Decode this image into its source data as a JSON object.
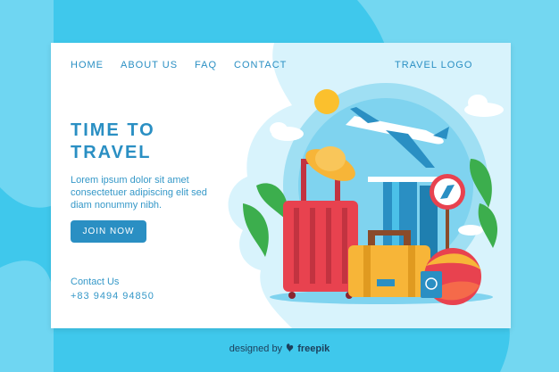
{
  "nav": {
    "items": [
      {
        "label": "HOME"
      },
      {
        "label": "ABOUT US"
      },
      {
        "label": "FAQ"
      },
      {
        "label": "CONTACT"
      }
    ],
    "logo": "TRAVEL LOGO"
  },
  "hero": {
    "headline": "TIME TO TRAVEL",
    "body": "Lorem ipsum dolor sit amet consectetuer adipiscing elit sed diam nonummy nibh.",
    "cta_label": "JOIN NOW"
  },
  "contact": {
    "title": "Contact Us",
    "phone": "+83 9494 94850"
  },
  "footer": {
    "credit_prefix": "designed by",
    "credit_brand": "freepik"
  },
  "colors": {
    "background": "#3fc8ec",
    "accent": "#2a8fc3",
    "suitcase_red": "#e8424f",
    "suitcase_yellow": "#f7b538",
    "sky_circle": "#bfe9f8"
  },
  "icons": [
    "airplane-icon",
    "sun-icon",
    "hat-icon",
    "compass-icon",
    "beach-ball-icon",
    "passport-icon",
    "freepik-logo-icon"
  ]
}
